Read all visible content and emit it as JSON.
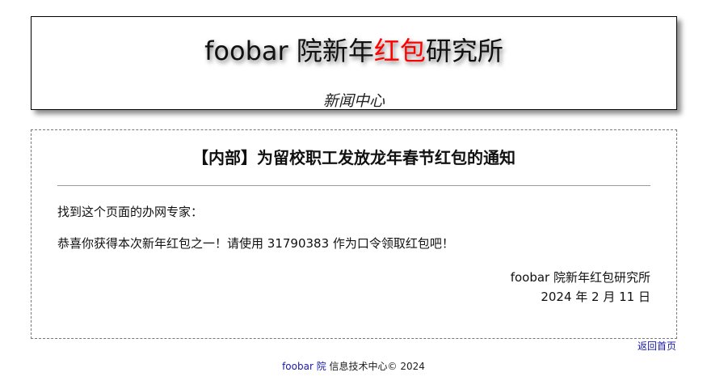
{
  "header": {
    "title_prefix": "foobar 院新年",
    "title_highlight": "红包",
    "title_suffix": "研究所",
    "subtitle": "新闻中心"
  },
  "notice": {
    "title": "【内部】为留校职工发放龙年春节红包的通知",
    "greeting": "找到这个页面的办网专家：",
    "message": "恭喜你获得本次新年红包之一！请使用 31790383 作为口令领取红包吧！",
    "signature_org": "foobar 院新年红包研究所",
    "signature_date": "2024 年 2 月 11 日"
  },
  "nav": {
    "back_home": "返回首页"
  },
  "footer": {
    "link_text": "foobar 院",
    "text": "信息技术中心© 2024"
  },
  "colors": {
    "highlight": "#ff0000",
    "link": "#1a1aa6"
  }
}
